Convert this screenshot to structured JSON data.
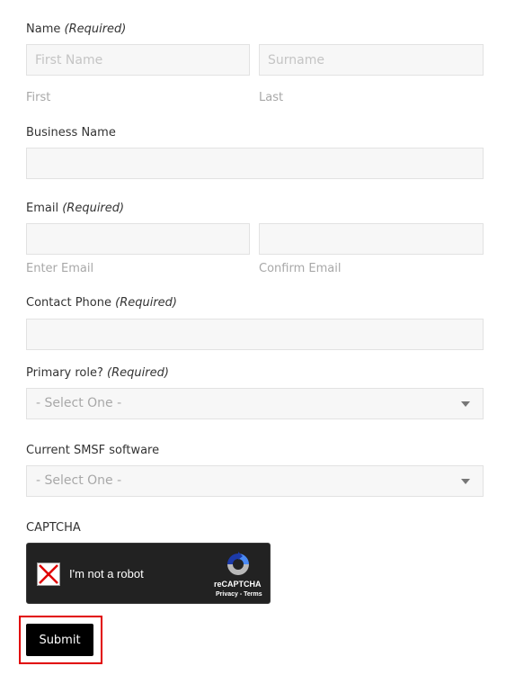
{
  "form": {
    "name": {
      "label": "Name",
      "required": "(Required)",
      "first_placeholder": "First Name",
      "surname_placeholder": "Surname",
      "first_sublabel": "First",
      "last_sublabel": "Last"
    },
    "business": {
      "label": "Business Name"
    },
    "email": {
      "label": "Email",
      "required": "(Required)",
      "enter_sublabel": "Enter Email",
      "confirm_sublabel": "Confirm Email"
    },
    "phone": {
      "label": "Contact Phone",
      "required": "(Required)"
    },
    "role": {
      "label": "Primary role?",
      "required": "(Required)",
      "selected": "- Select One -"
    },
    "software": {
      "label": "Current SMSF software",
      "selected": "- Select One -"
    },
    "captcha": {
      "label": "CAPTCHA",
      "checkbox_text": "I'm not a robot",
      "brand": "reCAPTCHA",
      "links": "Privacy - Terms"
    },
    "submit_label": "Submit"
  },
  "colors": {
    "accent_outline": "#e10000",
    "submit_bg": "#000000",
    "captcha_bg": "#222222"
  }
}
